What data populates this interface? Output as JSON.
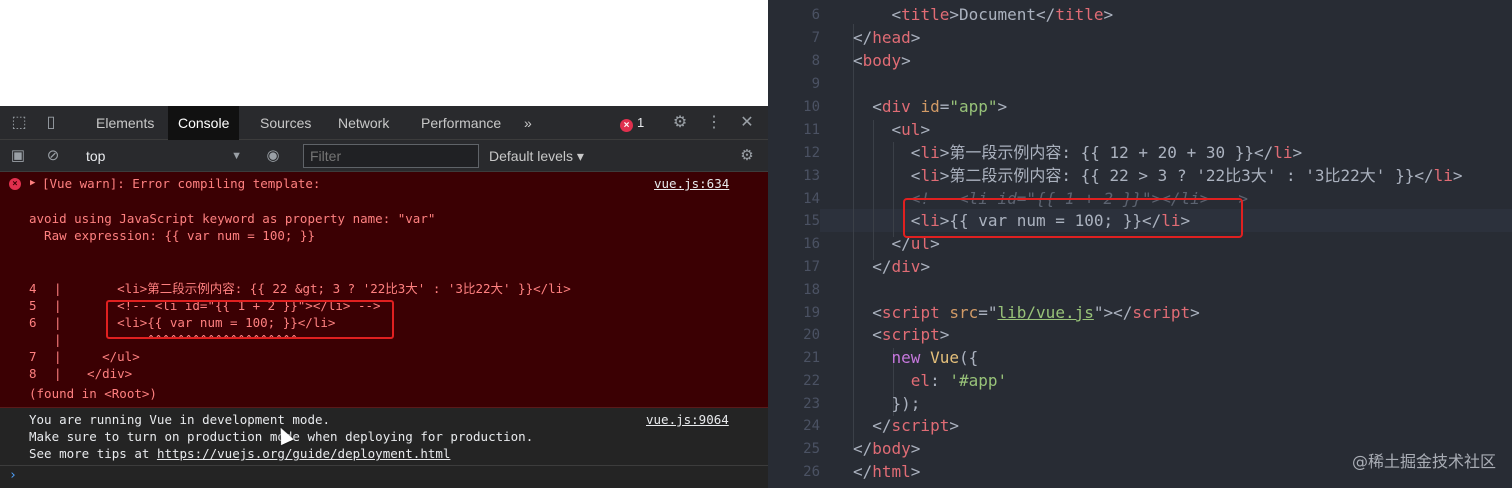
{
  "devtools": {
    "tabs": [
      "Elements",
      "Console",
      "Sources",
      "Network",
      "Performance"
    ],
    "more_tabs": "»",
    "error_count": "1",
    "context": "top",
    "filter_placeholder": "Filter",
    "levels": "Default levels ▾",
    "icons": [
      "inspect-icon",
      "device-toggle-icon",
      "error-icon",
      "settings-icon",
      "more-vert-icon",
      "close-icon",
      "sidebar-icon",
      "clear-icon",
      "eye-icon"
    ]
  },
  "console": {
    "error": {
      "header": "[Vue warn]: Error compiling template:",
      "source": "vue.js:634",
      "message1": "avoid using JavaScript keyword as property name: \"var\"",
      "message2": "  Raw expression: {{ var num = 100; }}",
      "code": [
        {
          "no": "4",
          "bar": "|",
          "text": "      <li>第二段示例内容: {{ 22 &gt; 3 ? '22比3大' : '3比22大' }}</li>"
        },
        {
          "no": "5",
          "bar": "|",
          "text": "      <!-- <li id=\"{{ 1 + 2 }}\"></li> -->"
        },
        {
          "no": "6",
          "bar": "|",
          "text": "      <li>{{ var num = 100; }}</li>"
        },
        {
          "no": "",
          "bar": "|",
          "text": "          ^^^^^^^^^^^^^^^^^^^^"
        },
        {
          "no": "7",
          "bar": "|",
          "text": "    </ul>"
        },
        {
          "no": "8",
          "bar": "|",
          "text": "  </div>"
        }
      ],
      "found_in": "(found in <Root>)"
    },
    "info": {
      "line1": "You are running Vue in development mode.",
      "source": "vue.js:9064",
      "line2": "Make sure to turn on production mode when deploying for production.",
      "line3_prefix": "See more tips at ",
      "line3_url": "https://vuejs.org/guide/deployment.html"
    },
    "prompt": "›"
  },
  "editor": {
    "line_numbers": [
      "6",
      "7",
      "8",
      "9",
      "10",
      "11",
      "12",
      "13",
      "14",
      "15",
      "16",
      "17",
      "18",
      "19",
      "20",
      "21",
      "22",
      "23",
      "24",
      "25",
      "26"
    ],
    "texts": {
      "title_content": "Document",
      "li1_content": "第一段示例内容: {{ 12 + 20 + 30 }}",
      "li2_content": "第二段示例内容: {{ 22 > 3 ? '22比3大' : '3比22大' }}",
      "comment": "<!-- <li id=\"{{ 1 + 2 }}\"></li> -->",
      "li3_content": "{{ var num = 100; }}",
      "div_id_attr": "id",
      "div_id_val": "\"app\"",
      "script_src_attr": "src",
      "script_src_val": "lib/vue.js",
      "new_kw": "new",
      "vue_fn": "Vue",
      "el_key": "el",
      "el_val": "'#app'"
    },
    "watermark": "@稀土掘金技术社区"
  }
}
